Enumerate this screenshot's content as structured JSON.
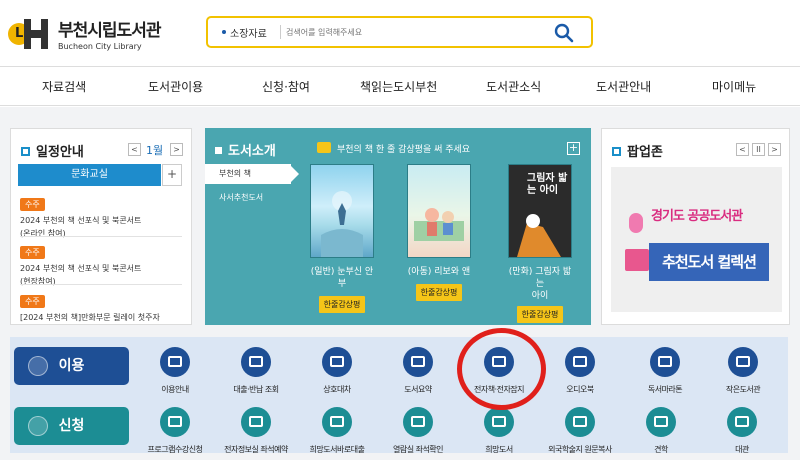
{
  "header": {
    "logo_mark": "L",
    "logo_ko": "부천시립도서관",
    "logo_en": "Bucheon City Library",
    "search_scope": "소장자료",
    "search_placeholder": "검색어를 입력해주세요",
    "search_icon": "search-icon"
  },
  "nav": [
    "자료검색",
    "도서관이용",
    "신청·참여",
    "책읽는도시부천",
    "도서관소식",
    "도서관안내",
    "마이메뉴"
  ],
  "schedule": {
    "title": "일정안내",
    "month": "1월",
    "tab": "문화교실",
    "prev": "<",
    "next": ">",
    "plus": "+",
    "events": [
      {
        "badge": "수주",
        "lines": [
          "2024 부천의 책 선포식 및 북콘서트",
          "(온라인 참여)"
        ]
      },
      {
        "badge": "수주",
        "lines": [
          "2024 부천의 책 선포식 및 북콘서트",
          "(현장참여)"
        ]
      },
      {
        "badge": "수주",
        "lines": [
          "[2024 부천의 책]만화부문 릴레이 첫주자"
        ]
      }
    ]
  },
  "book_intro": {
    "title": "도서소개",
    "promo": "부천의 책 한 줄 감상평을 써 주세요",
    "plus": "+",
    "tabs": [
      "부천의 책",
      "사서추천도서"
    ],
    "books": [
      {
        "name": "(일반) 눈부신 안부",
        "button": "한줄감상평"
      },
      {
        "name": "(아동) 리보와 앤",
        "button": "한줄감상평"
      },
      {
        "name_lines": [
          "(만화) 그림자 밟는",
          "아이"
        ],
        "button": "한줄감상평",
        "cover_text": "그림자 밟는 아이"
      }
    ]
  },
  "popup": {
    "title": "팝업존",
    "prev": "<",
    "pause": "II",
    "next": ">",
    "line1": "경기도 공공도서관",
    "line2": "추천도서 컬렉션"
  },
  "quick": {
    "use_label": "이용",
    "apply_label": "신청",
    "use_items": [
      "이용안내",
      "대출·반납 조회",
      "상호대차",
      "도서요약",
      "전자책·전자잡지",
      "오디오북",
      "독서마라톤",
      "작은도서관"
    ],
    "apply_items": [
      "프로그램수강신청",
      "전자정보실 좌석예약",
      "희망도서바로대출",
      "열람실 좌석확인",
      "희망도서",
      "외국학술지 원문복사",
      "견학",
      "대관"
    ]
  },
  "colors": {
    "accent_yellow": "#f2c200",
    "blue": "#1e4f95",
    "teal": "#1c8d94",
    "highlight_red": "#e0201b"
  }
}
